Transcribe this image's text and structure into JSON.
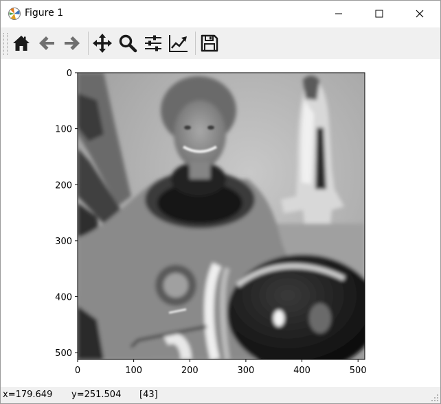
{
  "window": {
    "title": "Figure 1"
  },
  "toolbar": {
    "buttons": [
      {
        "name": "home",
        "icon": "home-icon"
      },
      {
        "name": "back",
        "icon": "arrow-left-icon"
      },
      {
        "name": "forward",
        "icon": "arrow-right-icon"
      },
      {
        "name": "pan",
        "icon": "move-icon"
      },
      {
        "name": "zoom",
        "icon": "magnifier-icon"
      },
      {
        "name": "subplots",
        "icon": "sliders-icon"
      },
      {
        "name": "edit-axis",
        "icon": "line-chart-icon"
      },
      {
        "name": "save",
        "icon": "floppy-disk-icon"
      }
    ]
  },
  "plot": {
    "x_ticks": [
      "0",
      "100",
      "200",
      "300",
      "400",
      "500"
    ],
    "y_ticks": [
      "0",
      "100",
      "200",
      "300",
      "400",
      "500"
    ],
    "image": "grayscale smoothed photo of astronaut in spacesuit with flag and space shuttle model"
  },
  "status": {
    "x": "x=179.649",
    "y": "y=251.504",
    "value": "[43]"
  },
  "colors": {
    "toolbar_bg": "#f0f0f0",
    "icon": "#1a1a1a",
    "icon_disabled": "#707070"
  }
}
